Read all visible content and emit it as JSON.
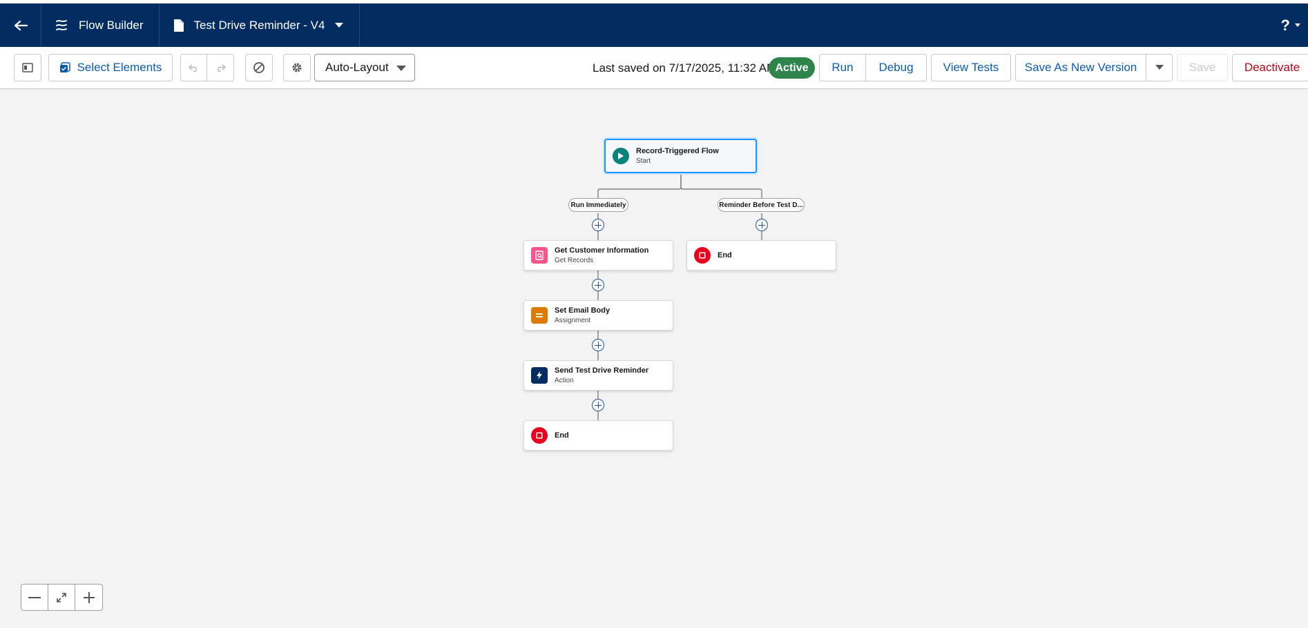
{
  "header": {
    "app_name": "Flow Builder",
    "file_name": "Test Drive Reminder - V4",
    "help_label": "?"
  },
  "toolbar": {
    "select_elements": "Select Elements",
    "layout_value": "Auto-Layout",
    "last_saved": "Last saved on 7/17/2025, 11:32 AM",
    "status": "Active",
    "run": "Run",
    "debug": "Debug",
    "view_tests": "View Tests",
    "save_as_new_version": "Save As New Version",
    "save": "Save",
    "deactivate": "Deactivate"
  },
  "flow": {
    "start": {
      "title": "Record-Triggered Flow",
      "subtitle": "Start"
    },
    "paths": [
      "Run Immediately",
      "Reminder Before Test D..."
    ],
    "left_nodes": [
      {
        "title": "Get Customer Information",
        "subtitle": "Get Records",
        "icon": "get-records-icon",
        "color": "#ff538a"
      },
      {
        "title": "Set Email Body",
        "subtitle": "Assignment",
        "icon": "assignment-icon",
        "color": "#dd7a01"
      },
      {
        "title": "Send Test Drive Reminder",
        "subtitle": "Action",
        "icon": "action-icon",
        "color": "#032d60"
      },
      {
        "title": "End",
        "subtitle": "",
        "icon": "end-icon",
        "color": "#ea001e"
      }
    ],
    "right_end": {
      "title": "End"
    }
  },
  "colors": {
    "header_bg": "#032d60",
    "brand_blue": "#0b5cab",
    "active_green": "#2e844a",
    "deactivate_red": "#ba0517"
  }
}
